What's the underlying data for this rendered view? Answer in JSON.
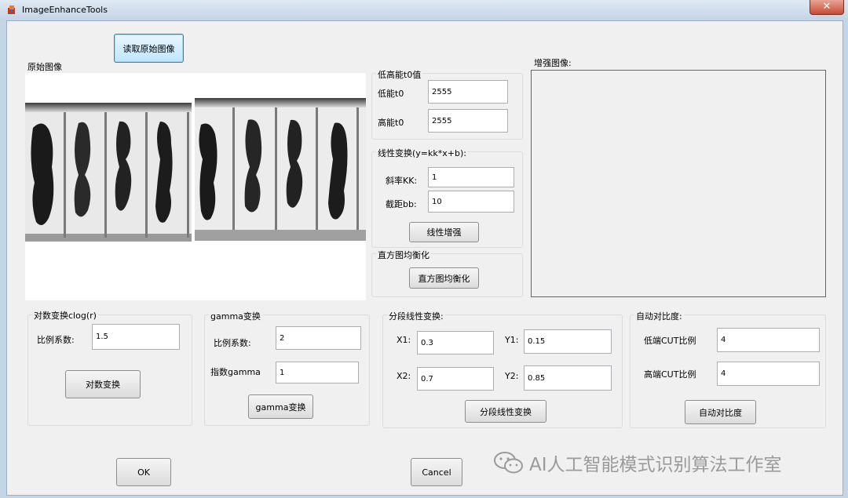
{
  "window": {
    "title": "ImageEnhanceTools",
    "close_glyph": "✕"
  },
  "top": {
    "read_button": "读取原始图像",
    "original_label": "原始图像",
    "enhanced_label": "增强图像:"
  },
  "t0": {
    "group_title": "低高能t0值",
    "low_label": "低能t0",
    "low_value": "2555",
    "high_label": "高能t0",
    "high_value": "2555"
  },
  "linear": {
    "group_title": "线性变换(y=kk*x+b):",
    "slope_label": "斜率KK:",
    "slope_value": "1",
    "intercept_label": "截距bb:",
    "intercept_value": "10",
    "button": "线性增强"
  },
  "hist": {
    "group_title": "直方图均衡化",
    "button": "直方图均衡化"
  },
  "log": {
    "group_title": "对数变换clog(r)",
    "ratio_label": "比例系数:",
    "ratio_value": "1.5",
    "button": "对数变换"
  },
  "gamma": {
    "group_title": "gamma变换",
    "ratio_label": "比例系数:",
    "ratio_value": "2",
    "exp_label": "指数gamma",
    "exp_value": "1",
    "button": "gamma变换"
  },
  "piecewise": {
    "group_title": "分段线性变换:",
    "x1_label": "X1:",
    "x1_value": "0.3",
    "y1_label": "Y1:",
    "y1_value": "0.15",
    "x2_label": "X2:",
    "x2_value": "0.7",
    "y2_label": "Y2:",
    "y2_value": "0.85",
    "button": "分段线性变换"
  },
  "contrast": {
    "group_title": "自动对比度:",
    "low_label": "低端CUT比例",
    "low_value": "4",
    "high_label": "高端CUT比例",
    "high_value": "4",
    "button": "自动对比度"
  },
  "footer": {
    "ok": "OK",
    "cancel": "Cancel",
    "watermark": "AI人工智能模式识别算法工作室"
  }
}
